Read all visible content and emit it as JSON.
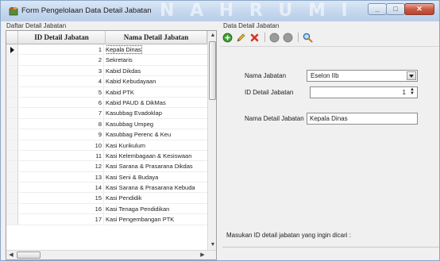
{
  "window": {
    "title": "Form Pengelolaan Data Detail Jabatan",
    "watermark": "N A H  R U M I",
    "minimize_icon": "minimize-icon",
    "maximize_icon": "maximize-icon",
    "close_icon": "close-icon"
  },
  "left_panel": {
    "label": "Daftar Detail Jabatan",
    "columns": [
      "ID Detail Jabatan",
      "Nama Detail Jabatan"
    ],
    "rows": [
      {
        "id": "1",
        "name": "Kepala Dinas"
      },
      {
        "id": "2",
        "name": "Sekretaris"
      },
      {
        "id": "3",
        "name": "Kabid Dikdas"
      },
      {
        "id": "4",
        "name": "Kabid Kebudayaan"
      },
      {
        "id": "5",
        "name": "Kabid PTK"
      },
      {
        "id": "6",
        "name": "Kabid PAUD & DikMas"
      },
      {
        "id": "7",
        "name": "Kasubbag Evadoklap"
      },
      {
        "id": "8",
        "name": "Kasubbag Umpeg"
      },
      {
        "id": "9",
        "name": "Kasubbag Perenc & Keu"
      },
      {
        "id": "10",
        "name": "Kasi Kurikulum"
      },
      {
        "id": "11",
        "name": "Kasi Kelembagaan & Kesiswaan"
      },
      {
        "id": "12",
        "name": "Kasi Sarana & Prasarana Dikdas"
      },
      {
        "id": "13",
        "name": "Kasi Seni & Budaya"
      },
      {
        "id": "14",
        "name": "Kasi Sarana & Prasarana Kebuda"
      },
      {
        "id": "15",
        "name": "Kasi Pendidik"
      },
      {
        "id": "16",
        "name": "Kasi Tenaga Pendidikan"
      },
      {
        "id": "17",
        "name": "Kasi Pengembangan PTK"
      }
    ],
    "selected_row": 0
  },
  "right_panel": {
    "label": "Data Detail Jabatan",
    "toolbar": [
      "add-icon",
      "edit-icon",
      "delete-icon",
      "save-icon",
      "cancel-icon",
      "search-icon"
    ],
    "fields": {
      "nama_jabatan_label": "Nama Jabatan",
      "nama_jabatan_value": "Eselon IIb",
      "id_detail_label": "ID Detail Jabatan",
      "id_detail_value": "1",
      "nama_detail_label": "Nama Detail Jabatan",
      "nama_detail_value": "Kepala Dinas"
    },
    "search_label": "Masukan ID detail jabatan yang ingin dicari :"
  },
  "colors": {
    "titlebar": "#c5d7ee",
    "close_button": "#c75c46",
    "window_bg": "#f0f0f0"
  }
}
